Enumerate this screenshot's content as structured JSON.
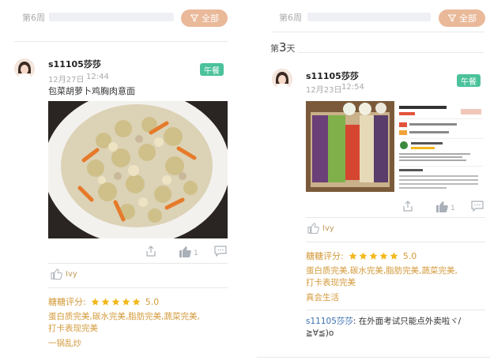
{
  "filter_label": "全部",
  "left": {
    "week": "第6周",
    "post": {
      "username": "s11105莎莎",
      "date": "12月27日",
      "time": "12:44",
      "meal": "午餐",
      "text": "包菜胡萝卜鸡胸肉意面",
      "like_count": "1",
      "liked_by": "Ivy",
      "rating_label": "糖糖评分:",
      "rating_stars": 5,
      "rating_score": "5.0",
      "feedback_line1": "蛋白质完美,碳水完美,脂肪完美,蔬菜完美,",
      "feedback_line2": "打卡表现完美",
      "feedback_note": "一锅乱炒"
    }
  },
  "right": {
    "week": "第6周",
    "day_prefix": "第",
    "day_number": "3",
    "day_suffix": "天",
    "post": {
      "username": "s11105莎莎",
      "date": "12月23日",
      "time": "12:54",
      "meal": "午餐",
      "like_count": "1",
      "liked_by": "Ivy",
      "rating_label": "糖糖评分:",
      "rating_stars": 5,
      "rating_score": "5.0",
      "feedback_line1": "蛋白质完美,碳水完美,脂肪完美,蔬菜完美,",
      "feedback_line2": "打卡表现完美",
      "feedback_note": "真会生活",
      "reply_user": "s11105莎莎",
      "reply_text": ": 在外面考试只能点外卖啦ヾ/",
      "reply_text2": "≧∀≦)o"
    }
  },
  "colors": {
    "accent": "#e9b99a",
    "meal_badge": "#4bc29b",
    "rating": "#d39a3a",
    "reply_user": "#3a6fb0"
  }
}
